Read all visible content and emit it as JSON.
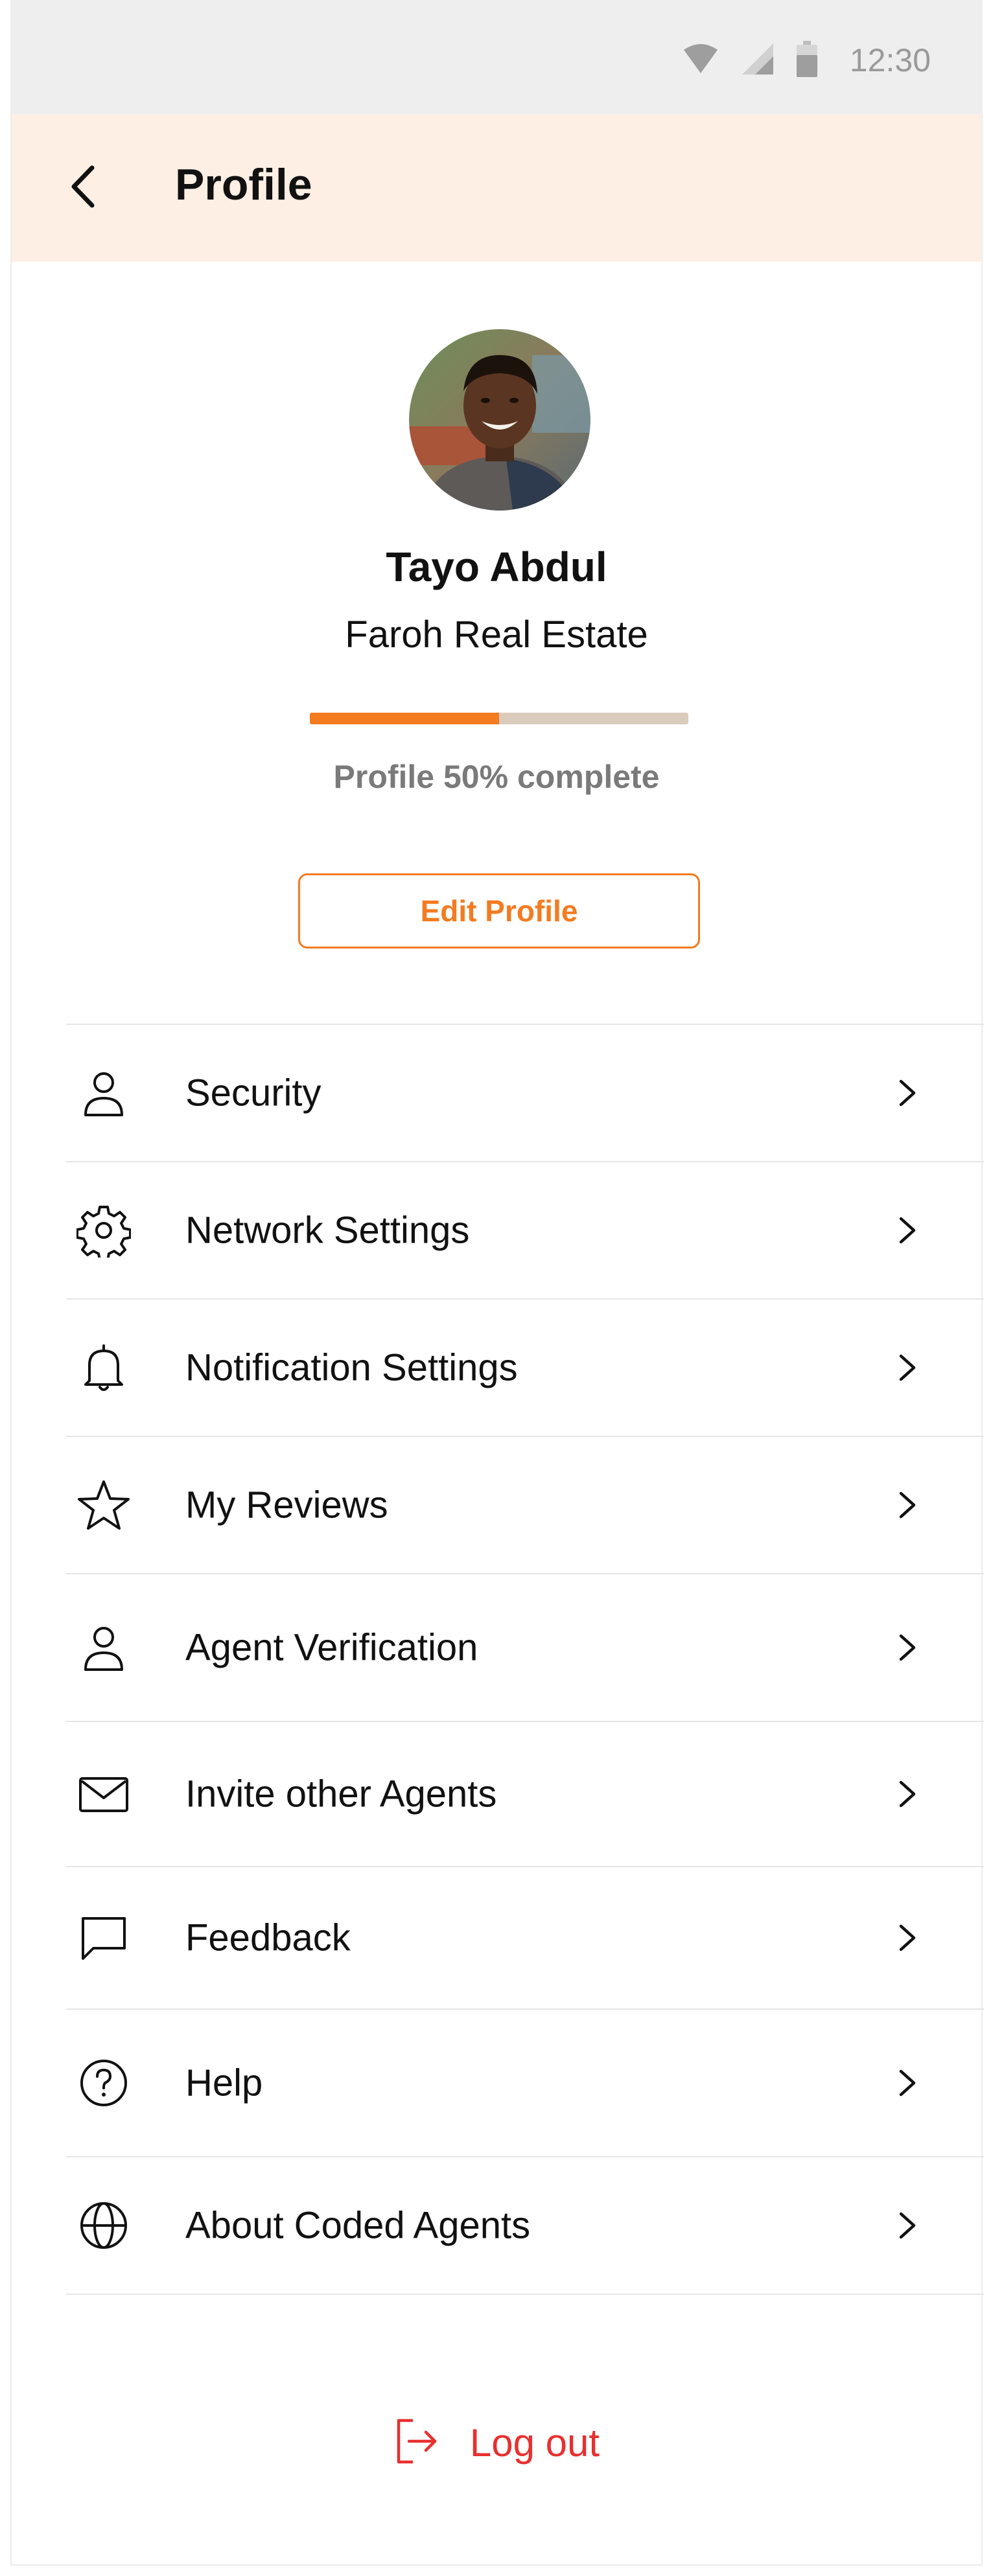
{
  "status_bar": {
    "time": "12:30",
    "icons": [
      "wifi-icon",
      "cellular-signal-icon",
      "battery-icon"
    ]
  },
  "header": {
    "title": "Profile",
    "back_icon": "chevron-left-icon"
  },
  "profile": {
    "name": "Tayo Abdul",
    "company": "Faroh Real Estate",
    "progress_percent": 50,
    "progress_text": "Profile 50% complete",
    "edit_button_label": "Edit Profile"
  },
  "menu": {
    "items": [
      {
        "label": "Security",
        "icon": "user-icon"
      },
      {
        "label": "Network Settings",
        "icon": "gear-icon"
      },
      {
        "label": "Notification Settings",
        "icon": "bell-icon"
      },
      {
        "label": "My Reviews",
        "icon": "star-icon"
      },
      {
        "label": "Agent Verification",
        "icon": "user-icon"
      },
      {
        "label": "Invite other Agents",
        "icon": "mail-icon"
      },
      {
        "label": "Feedback",
        "icon": "chat-bubble-icon"
      },
      {
        "label": "Help",
        "icon": "question-circle-icon"
      },
      {
        "label": "About Coded Agents",
        "icon": "globe-icon"
      }
    ]
  },
  "logout": {
    "label": "Log out",
    "icon": "logout-icon"
  },
  "colors": {
    "accent": "#f47b20",
    "header_bg": "#fdefe4",
    "status_bar_bg": "#eeeeee",
    "progress_track": "#dacbbd",
    "logout": "#e8302f",
    "divider": "#e6e6e6"
  }
}
